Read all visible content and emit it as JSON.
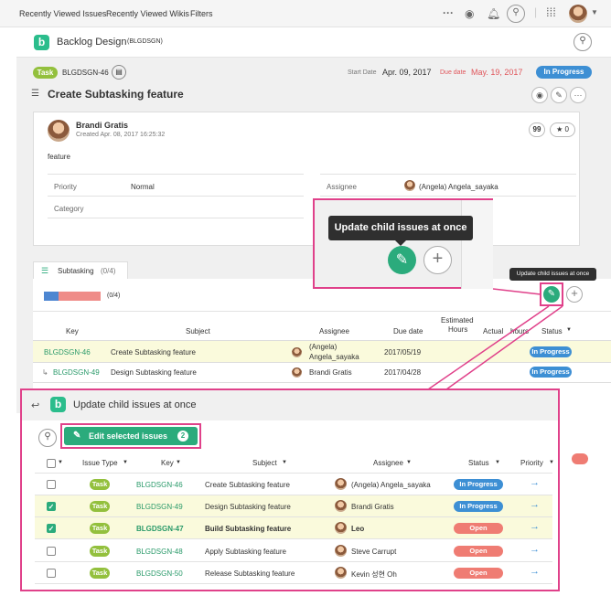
{
  "topnav": {
    "recent_issues": "Recently Viewed Issues",
    "recent_wikis": "Recently Viewed Wikis",
    "filters": "Filters",
    "more": "···"
  },
  "project": {
    "logo": "b",
    "name": "Backlog Design",
    "key": "(BLGDSGN)"
  },
  "issue": {
    "type": "Task",
    "key": "BLGDSGN-46",
    "start_label": "Start Date",
    "start_date": "Apr. 09, 2017",
    "due_label": "Due date",
    "due_date": "May. 19, 2017",
    "status": "In Progress",
    "title": "Create Subtasking feature",
    "author": "Brandi Gratis",
    "created": "Created  Apr. 08, 2017 16:25:32",
    "description": "feature",
    "quote_count": "99",
    "star_count": "0",
    "fields": {
      "priority_label": "Priority",
      "priority": "Normal",
      "assignee_label": "Assignee",
      "assignee": "(Angela) Angela_sayaka",
      "category_label": "Category"
    }
  },
  "tooltip_big": "Update child issues at once",
  "tooltip_small": "Update child issues at once",
  "subtasking": {
    "tab_label": "Subtasking",
    "tab_count": "(0/4)",
    "progress_text": "(0/4)",
    "headers": {
      "key": "Key",
      "subject": "Subject",
      "assignee": "Assignee",
      "due": "Due date",
      "est1": "Estimated",
      "est2": "Hours",
      "actual": "Actual",
      "hours": "hours",
      "status": "Status"
    },
    "rows": [
      {
        "key": "BLGDSGN-46",
        "subject": "Create Subtasking feature",
        "assignee1": "(Angela)",
        "assignee2": "Angela_sayaka",
        "due": "2017/05/19",
        "status": "In Progress"
      },
      {
        "key": "BLGDSGN-49",
        "subject": "Design Subtasking feature",
        "assignee1": "Brandi Gratis",
        "assignee2": "",
        "due": "2017/04/28",
        "status": "In Progress"
      }
    ]
  },
  "panel": {
    "title": "Update child issues at once",
    "edit_label": "Edit selected issues",
    "edit_count": "2",
    "headers": {
      "issue_type": "Issue Type",
      "key": "Key",
      "subject": "Subject",
      "assignee": "Assignee",
      "status": "Status",
      "priority": "Priority"
    },
    "rows": [
      {
        "type": "Task",
        "key": "BLGDSGN-46",
        "subject": "Create Subtasking feature",
        "assignee": "(Angela) Angela_sayaka",
        "status": "In Progress",
        "checked": false
      },
      {
        "type": "Task",
        "key": "BLGDSGN-49",
        "subject": "Design Subtasking feature",
        "assignee": "Brandi Gratis",
        "status": "In Progress",
        "checked": true
      },
      {
        "type": "Task",
        "key": "BLGDSGN-47",
        "subject": "Build Subtasking feature",
        "assignee": "Leo",
        "status": "Open",
        "checked": true
      },
      {
        "type": "Task",
        "key": "BLGDSGN-48",
        "subject": "Apply Subtasking feature",
        "assignee": "Steve Carrupt",
        "status": "Open",
        "checked": false
      },
      {
        "type": "Task",
        "key": "BLGDSGN-50",
        "subject": "Release Subtasking feature",
        "assignee": "Kevin 성현 Oh",
        "status": "Open",
        "checked": false
      }
    ]
  }
}
